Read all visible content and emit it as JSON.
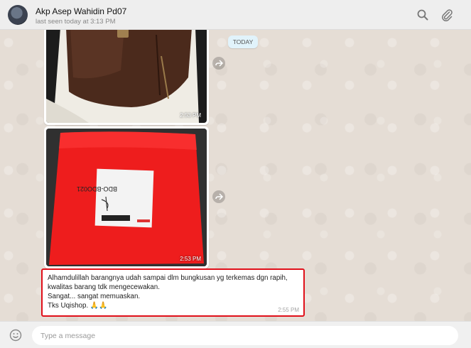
{
  "header": {
    "contact_name": "Akp Asep Wahidin Pd07",
    "last_seen": "last seen today at 3:13 PM",
    "icons": [
      "search-icon",
      "attach-icon"
    ]
  },
  "chat": {
    "date_label": "TODAY",
    "messages": [
      {
        "type": "image",
        "subject": "brown leather bag",
        "time": "2:53 PM"
      },
      {
        "type": "image",
        "subject": "red packaged parcel",
        "label_code": "BDO-BDO021",
        "time": "2:53 PM"
      },
      {
        "type": "text",
        "lines": [
          "Alhamdulillah barangnya udah sampai dlm bungkusan yg terkemas dgn rapih,",
          "kwalitas barang tdk mengecewakan.",
          "Sangat... sangat memuaskan.",
          "Tks Uqishop. 🙏🙏"
        ],
        "time": "2:55 PM"
      }
    ]
  },
  "composer": {
    "placeholder": "Type a message"
  },
  "colors": {
    "chat_bg": "#e5ddd5",
    "highlight_border": "#e0101a",
    "header_bg": "#eeeeee"
  }
}
